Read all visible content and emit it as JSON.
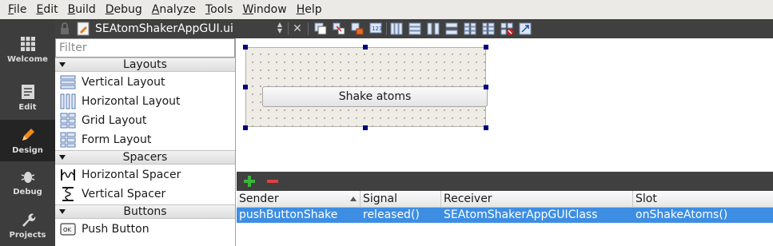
{
  "menubar": {
    "items": [
      {
        "accel": "F",
        "rest": "ile"
      },
      {
        "accel": "E",
        "rest": "dit"
      },
      {
        "accel": "B",
        "rest": "uild"
      },
      {
        "accel": "D",
        "rest": "ebug"
      },
      {
        "accel": "A",
        "rest": "nalyze"
      },
      {
        "accel": "T",
        "rest": "ools"
      },
      {
        "accel": "W",
        "rest": "indow"
      },
      {
        "accel": "H",
        "rest": "elp"
      }
    ]
  },
  "modes": [
    {
      "label": "Welcome",
      "icon": "grid-icon",
      "active": false
    },
    {
      "label": "Edit",
      "icon": "document-icon",
      "active": false
    },
    {
      "label": "Design",
      "icon": "pencil-icon",
      "active": true
    },
    {
      "label": "Debug",
      "icon": "bug-icon",
      "active": false
    },
    {
      "label": "Projects",
      "icon": "wrench-icon",
      "active": false
    }
  ],
  "editor_toolbar": {
    "document_title": "SEAtomShakerAppGUI.ui",
    "tools": [
      "edit-widgets-icon",
      "edit-signals-slots-icon",
      "edit-buddies-icon",
      "edit-tab-order-icon",
      "layout-horizontal-icon",
      "layout-vertical-icon",
      "layout-horizontal-splitter-icon",
      "layout-vertical-splitter-icon",
      "layout-grid-icon",
      "layout-form-icon",
      "break-layout-icon",
      "adjust-size-icon"
    ]
  },
  "widgetbox": {
    "filter_placeholder": "Filter",
    "categories": [
      {
        "title": "Layouts",
        "items": [
          {
            "label": "Vertical Layout",
            "icon": "vertical-layout-icon"
          },
          {
            "label": "Horizontal Layout",
            "icon": "horizontal-layout-icon"
          },
          {
            "label": "Grid Layout",
            "icon": "grid-layout-icon"
          },
          {
            "label": "Form Layout",
            "icon": "form-layout-icon"
          }
        ]
      },
      {
        "title": "Spacers",
        "items": [
          {
            "label": "Horizontal Spacer",
            "icon": "horizontal-spacer-icon"
          },
          {
            "label": "Vertical Spacer",
            "icon": "vertical-spacer-icon"
          }
        ]
      },
      {
        "title": "Buttons",
        "items": [
          {
            "label": "Push Button",
            "icon": "push-button-icon"
          }
        ]
      }
    ]
  },
  "form": {
    "button_text": "Shake atoms"
  },
  "signal_slot_editor": {
    "columns": [
      "Sender",
      "Signal",
      "Receiver",
      "Slot"
    ],
    "rows": [
      {
        "sender": "pushButtonShake",
        "signal": "released()",
        "receiver": "SEAtomShakerAppGUIClass",
        "slot": "onShakeAtoms()"
      }
    ]
  },
  "colors": {
    "selection": "#3d8ee3",
    "sidebar": "#3d3d3d",
    "handle": "#000080"
  }
}
